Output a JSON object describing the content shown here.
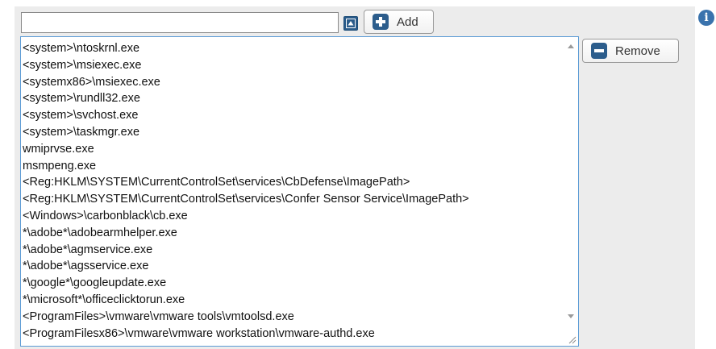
{
  "top_input": {
    "value": ""
  },
  "buttons": {
    "add_label": "Add",
    "remove_label": "Remove"
  },
  "icons": {
    "collapse": "triangle-up-icon",
    "add": "plus-icon",
    "remove": "minus-icon",
    "info": "info-icon",
    "info_glyph": "i"
  },
  "colors": {
    "accent": "#2c5d8c",
    "list_border": "#5b9bd5",
    "panel": "#ececec",
    "info": "#3a73ad"
  },
  "list": {
    "items": [
      "<system>\\ntoskrnl.exe",
      "<system>\\msiexec.exe",
      "<systemx86>\\msiexec.exe",
      "<system>\\rundll32.exe",
      "<system>\\svchost.exe",
      "<system>\\taskmgr.exe",
      "wmiprvse.exe",
      "msmpeng.exe",
      "<Reg:HKLM\\SYSTEM\\CurrentControlSet\\services\\CbDefense\\ImagePath>",
      "<Reg:HKLM\\SYSTEM\\CurrentControlSet\\services\\Confer Sensor Service\\ImagePath>",
      "<Windows>\\carbonblack\\cb.exe",
      "*\\adobe*\\adobearmhelper.exe",
      "*\\adobe*\\agmservice.exe",
      "*\\adobe*\\agsservice.exe",
      "*\\google*\\googleupdate.exe",
      "*\\microsoft*\\officeclicktorun.exe",
      "<ProgramFiles>\\vmware\\vmware tools\\vmtoolsd.exe",
      "<ProgramFilesx86>\\vmware\\vmware workstation\\vmware-authd.exe"
    ]
  }
}
